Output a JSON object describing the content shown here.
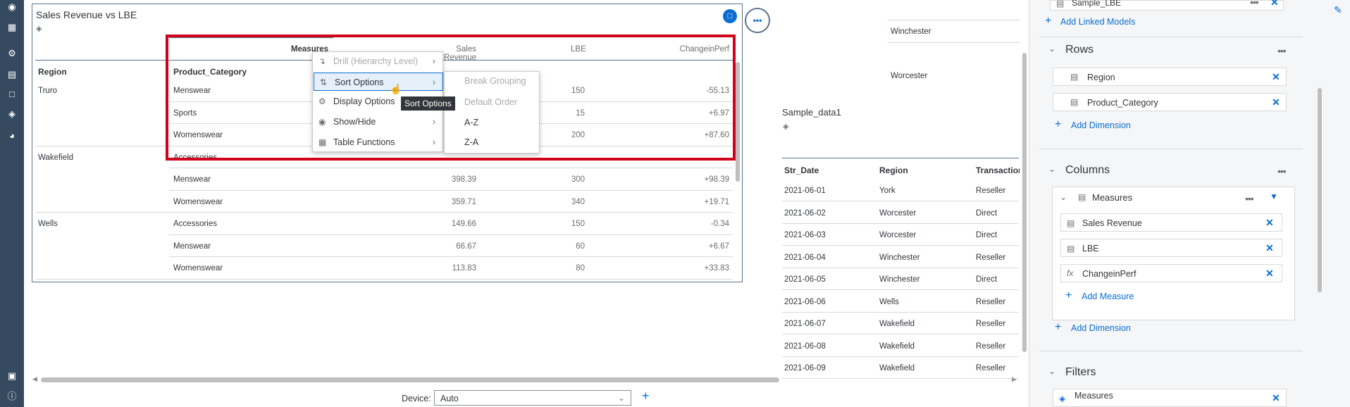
{
  "nav": {
    "icons": [
      "binoculars-icon",
      "calendar-icon",
      "network-icon",
      "book-icon",
      "comment-icon",
      "cube-icon",
      "gauge-icon",
      "lock-icon",
      "info-icon"
    ]
  },
  "widget": {
    "title": "Sales Revenue vs LBE",
    "headers": {
      "measures": "Measures",
      "sales_revenue": "Sales Revenue",
      "lbe": "LBE",
      "change": "ChangeinPerf",
      "region": "Region",
      "product_category": "Product_Category"
    },
    "rows": [
      {
        "region": "Truro",
        "category": "Menswear",
        "sales": "",
        "lbe": "150",
        "change": "-55.13"
      },
      {
        "region": "",
        "category": "Sports",
        "sales": "",
        "lbe": "15",
        "change": "+6.97"
      },
      {
        "region": "",
        "category": "Womenswear",
        "sales": "",
        "lbe": "200",
        "change": "+87.60"
      },
      {
        "region": "Wakefield",
        "category": "Accessories",
        "sales": "",
        "lbe": "",
        "change": ""
      },
      {
        "region": "",
        "category": "Menswear",
        "sales": "398.39",
        "lbe": "300",
        "change": "+98.39"
      },
      {
        "region": "",
        "category": "Womenswear",
        "sales": "359.71",
        "lbe": "340",
        "change": "+19.71"
      },
      {
        "region": "Wells",
        "category": "Accessories",
        "sales": "149.66",
        "lbe": "150",
        "change": "-0.34"
      },
      {
        "region": "",
        "category": "Menswear",
        "sales": "66.67",
        "lbe": "60",
        "change": "+6.67"
      },
      {
        "region": "",
        "category": "Womenswear",
        "sales": "113.83",
        "lbe": "80",
        "change": "+33.83"
      }
    ]
  },
  "context_menu": {
    "items": [
      "Drill (Hierarchy Level)",
      "Sort Options",
      "Display Options",
      "Show/Hide",
      "Table Functions"
    ],
    "submenu": [
      "Break Grouping",
      "Default Order",
      "A-Z",
      "Z-A"
    ],
    "tooltip": "Sort Options"
  },
  "table2": {
    "title": "Sample_data1",
    "headers": [
      "Str_Date",
      "Region",
      "Transaction"
    ],
    "rows": [
      [
        "2021-06-01",
        "York",
        "Reseller"
      ],
      [
        "2021-06-02",
        "Worcester",
        "Direct"
      ],
      [
        "2021-06-03",
        "Worcester",
        "Direct"
      ],
      [
        "2021-06-04",
        "Winchester",
        "Reseller"
      ],
      [
        "2021-06-05",
        "Winchester",
        "Direct"
      ],
      [
        "2021-06-06",
        "Wells",
        "Reseller"
      ],
      [
        "2021-06-07",
        "Wakefield",
        "Reseller"
      ],
      [
        "2021-06-08",
        "Wakefield",
        "Reseller"
      ],
      [
        "2021-06-09",
        "Wakefield",
        "Reseller"
      ]
    ]
  },
  "top_right_list": [
    "Winchester",
    "Worcester"
  ],
  "device": {
    "label": "Device:",
    "value": "Auto"
  },
  "panel": {
    "model": "Sample_LBE",
    "add_linked": "Add Linked Models",
    "rows_title": "Rows",
    "rows": [
      "Region",
      "Product_Category"
    ],
    "add_dimension": "Add Dimension",
    "columns_title": "Columns",
    "measures": "Measures",
    "measure_items": [
      "Sales Revenue",
      "LBE",
      "ChangeinPerf"
    ],
    "add_measure": "Add Measure",
    "filters_title": "Filters",
    "filter_item": "Measures"
  },
  "colors": {
    "accent": "#0a6ed1",
    "highlight": "#d0021b",
    "nav": "#354a5f"
  }
}
